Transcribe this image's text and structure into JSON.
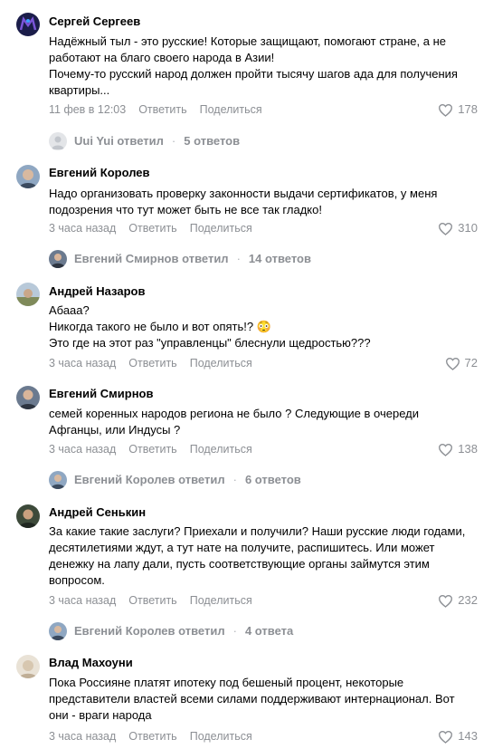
{
  "ui": {
    "reply_action": "Ответить",
    "share_action": "Поделиться"
  },
  "comments": [
    {
      "author": "Сергей Сергеев",
      "text": "Надёжный тыл - это русские! Которые защищают, помогают стране, а не работают на благо своего народа в Азии!\nПочему-то русский народ должен пройти тысячу шагов ада для получения квартиры...",
      "time": "11 фев в 12:03",
      "likes": "178",
      "reply": {
        "who": "Uui Yui ответил",
        "count": "5 ответов"
      }
    },
    {
      "author": "Евгений Королев",
      "text": "Надо организовать проверку законности выдачи сертификатов, у меня подозрения что тут может быть не все так гладко!",
      "time": "3 часа назад",
      "likes": "310",
      "reply": {
        "who": "Евгений Смирнов ответил",
        "count": "14 ответов"
      }
    },
    {
      "author": "Андрей Назаров",
      "text": "Абааа?\nНикогда такого не было и вот опять!? 😳\nЭто где на этот раз \"управленцы\" блеснули щедростью???",
      "time": "3 часа назад",
      "likes": "72"
    },
    {
      "author": "Евгений Смирнов",
      "text": "семей коренных народов региона не было ? Следующие в очереди Афганцы, или Индусы ?",
      "time": "3 часа назад",
      "likes": "138",
      "reply": {
        "who": "Евгений Королев ответил",
        "count": "6 ответов"
      }
    },
    {
      "author": "Андрей Сенькин",
      "text": "За какие такие заслуги? Приехали и получили? Наши русские люди годами, десятилетиями ждут, а тут нате на получите, распишитесь. Или может денежку на лапу дали, пусть соответствующие органы займутся этим вопросом.",
      "time": "3 часа назад",
      "likes": "232",
      "reply": {
        "who": "Евгений Королев ответил",
        "count": "4 ответа"
      }
    },
    {
      "author": "Влад Махоуни",
      "text": "Пока Россияне платят ипотеку под бешеный процент, некоторые представители властей всеми силами поддерживают интернационал. Вот они - враги народа",
      "time": "3 часа назад",
      "likes": "143"
    }
  ]
}
